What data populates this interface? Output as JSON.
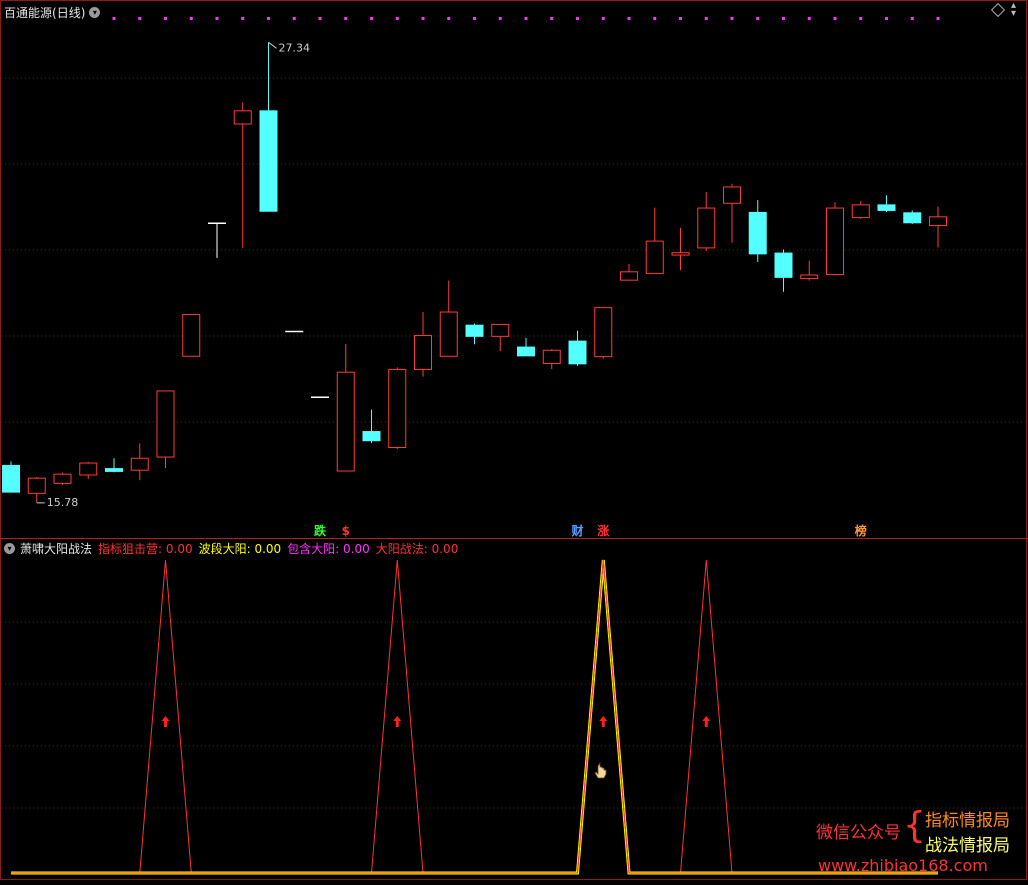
{
  "header": {
    "title": "百通能源",
    "period": "(日线)"
  },
  "markers": [
    {
      "text": "跌",
      "color": "#33ff33",
      "x_index": 12
    },
    {
      "text": "$",
      "color": "#ff3333",
      "x_index": 13
    },
    {
      "text": "财",
      "color": "#5aa0ff",
      "x_index": 22
    },
    {
      "text": "涨",
      "color": "#ff3333",
      "x_index": 23
    },
    {
      "text": "榜",
      "color": "#ff9933",
      "x_index": 33
    }
  ],
  "subchart": {
    "title": "萧啸大阳战法",
    "indicators": [
      {
        "label": "指标狙击营: 0.00",
        "color": "#ff3333"
      },
      {
        "label": "波段大阳: 0.00",
        "color": "#ffff00"
      },
      {
        "label": "包含大阳: 0.00",
        "color": "#ff33ff"
      },
      {
        "label": "大阳战法: 0.00",
        "color": "#ff3333"
      }
    ]
  },
  "watermark": {
    "left": "微信公众号",
    "right1": "指标情报局",
    "right2": "战法情报局",
    "url": "www.zhibiao168.com"
  },
  "chart_data": [
    {
      "type": "candlestick",
      "title": "百通能源 (日线)",
      "x_count": 37,
      "ylim": [
        15.3,
        27.9
      ],
      "max_label": {
        "text": "27.34",
        "index": 10,
        "value": 27.34
      },
      "min_label": {
        "text": "15.78",
        "index": 1,
        "value": 15.78
      },
      "bull_color": "#ff3b3b",
      "bear_color": "#54ffff",
      "candles": [
        {
          "o": 16.72,
          "h": 16.82,
          "l": 16.05,
          "c": 16.05
        },
        {
          "o": 16.02,
          "h": 16.43,
          "l": 15.78,
          "c": 16.4
        },
        {
          "o": 16.27,
          "h": 16.54,
          "l": 16.23,
          "c": 16.5
        },
        {
          "o": 16.48,
          "h": 16.81,
          "l": 16.38,
          "c": 16.78
        },
        {
          "o": 16.64,
          "h": 16.9,
          "l": 16.55,
          "c": 16.57
        },
        {
          "o": 16.6,
          "h": 17.27,
          "l": 16.35,
          "c": 16.9
        },
        {
          "o": 16.93,
          "h": 18.59,
          "l": 16.65,
          "c": 18.59
        },
        {
          "o": 19.46,
          "h": 20.51,
          "l": 19.46,
          "c": 20.51
        },
        {
          "o": 22.8,
          "h": 22.8,
          "l": 21.93,
          "c": 22.8
        },
        {
          "o": 25.29,
          "h": 25.83,
          "l": 22.18,
          "c": 25.62
        },
        {
          "o": 25.62,
          "h": 27.34,
          "l": 23.1,
          "c": 23.1
        },
        {
          "o": 20.08,
          "h": 20.08,
          "l": 20.08,
          "c": 20.08
        },
        {
          "o": 18.43,
          "h": 18.43,
          "l": 18.43,
          "c": 18.43
        },
        {
          "o": 16.58,
          "h": 19.77,
          "l": 16.58,
          "c": 19.06
        },
        {
          "o": 17.57,
          "h": 18.12,
          "l": 17.28,
          "c": 17.34
        },
        {
          "o": 17.17,
          "h": 19.18,
          "l": 17.13,
          "c": 19.13
        },
        {
          "o": 19.13,
          "h": 20.57,
          "l": 18.95,
          "c": 19.98
        },
        {
          "o": 19.46,
          "h": 21.36,
          "l": 19.46,
          "c": 20.57
        },
        {
          "o": 20.24,
          "h": 20.28,
          "l": 19.76,
          "c": 19.96
        },
        {
          "o": 19.96,
          "h": 20.26,
          "l": 19.59,
          "c": 20.26
        },
        {
          "o": 19.69,
          "h": 19.92,
          "l": 19.58,
          "c": 19.47
        },
        {
          "o": 19.28,
          "h": 19.64,
          "l": 19.14,
          "c": 19.61
        },
        {
          "o": 19.84,
          "h": 20.1,
          "l": 19.22,
          "c": 19.27
        },
        {
          "o": 19.45,
          "h": 20.47,
          "l": 19.4,
          "c": 20.68
        },
        {
          "o": 21.37,
          "h": 21.78,
          "l": 21.37,
          "c": 21.58
        },
        {
          "o": 21.54,
          "h": 23.19,
          "l": 21.54,
          "c": 22.35
        },
        {
          "o": 22.0,
          "h": 22.69,
          "l": 21.62,
          "c": 22.06
        },
        {
          "o": 22.18,
          "h": 23.58,
          "l": 22.11,
          "c": 23.18
        },
        {
          "o": 23.3,
          "h": 23.79,
          "l": 22.31,
          "c": 23.71
        },
        {
          "o": 23.07,
          "h": 23.38,
          "l": 21.83,
          "c": 22.03
        },
        {
          "o": 22.05,
          "h": 22.14,
          "l": 21.08,
          "c": 21.44
        },
        {
          "o": 21.41,
          "h": 21.86,
          "l": 21.36,
          "c": 21.5
        },
        {
          "o": 21.51,
          "h": 23.33,
          "l": 21.51,
          "c": 23.18
        },
        {
          "o": 22.94,
          "h": 23.36,
          "l": 22.91,
          "c": 23.26
        },
        {
          "o": 23.26,
          "h": 23.5,
          "l": 23.08,
          "c": 23.12
        },
        {
          "o": 23.06,
          "h": 23.12,
          "l": 22.78,
          "c": 22.81
        },
        {
          "o": 22.74,
          "h": 23.22,
          "l": 22.19,
          "c": 22.96
        }
      ]
    },
    {
      "type": "line",
      "title": "萧啸大阳战法",
      "x_count": 37,
      "ylim": [
        0,
        5
      ],
      "signal_arrow_indices": [
        6,
        15,
        23,
        27
      ],
      "series": [
        {
          "name": "指标狙击营",
          "color": "#ff3333",
          "values": [
            0,
            0,
            0,
            0,
            0,
            0,
            5,
            0,
            0,
            0,
            0,
            0,
            0,
            0,
            0,
            5,
            0,
            0,
            0,
            0,
            0,
            0,
            0,
            5,
            0,
            0,
            0,
            5,
            0,
            0,
            0,
            0,
            0,
            0,
            0,
            0,
            0
          ]
        },
        {
          "name": "波段大阳",
          "color": "#ffff00",
          "values": [
            0,
            0,
            0,
            0,
            0,
            0,
            0,
            0,
            0,
            0,
            0,
            0,
            0,
            0,
            0,
            0,
            0,
            0,
            0,
            0,
            0,
            0,
            0,
            5,
            0,
            0,
            0,
            0,
            0,
            0,
            0,
            0,
            0,
            0,
            0,
            0,
            0
          ]
        },
        {
          "name": "包含大阳",
          "color": "#ff33ff",
          "values": [
            0,
            0,
            0,
            0,
            0,
            0,
            0,
            0,
            0,
            0,
            0,
            0,
            0,
            0,
            0,
            0,
            0,
            0,
            0,
            0,
            0,
            0,
            0,
            0,
            0,
            0,
            0,
            0,
            0,
            0,
            0,
            0,
            0,
            0,
            0,
            0,
            0
          ]
        },
        {
          "name": "大阳战法",
          "color": "#ff3333",
          "values": [
            0,
            0,
            0,
            0,
            0,
            0,
            0,
            0,
            0,
            0,
            0,
            0,
            0,
            0,
            0,
            0,
            0,
            0,
            0,
            0,
            0,
            0,
            0,
            5,
            0,
            0,
            0,
            0,
            0,
            0,
            0,
            0,
            0,
            0,
            0,
            0,
            0
          ]
        }
      ]
    }
  ]
}
